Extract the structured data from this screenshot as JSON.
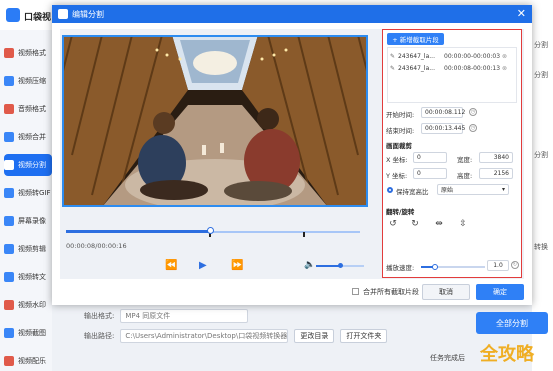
{
  "app": {
    "name": "口袋视",
    "sidebar": [
      {
        "label": "视频格式",
        "color": "#e05a4a"
      },
      {
        "label": "视频压缩",
        "color": "#3a86f7"
      },
      {
        "label": "音频格式",
        "color": "#e05a4a"
      },
      {
        "label": "视频合并",
        "color": "#3a86f7"
      },
      {
        "label": "视频分割",
        "color": "#e05a4a",
        "active": true
      },
      {
        "label": "视频转GIF",
        "color": "#3a86f7"
      },
      {
        "label": "屏幕录像",
        "color": "#3a86f7"
      },
      {
        "label": "视频剪辑",
        "color": "#3a86f7"
      },
      {
        "label": "视频转文",
        "color": "#3a86f7"
      },
      {
        "label": "视频水印",
        "color": "#e05a4a"
      },
      {
        "label": "视频截图",
        "color": "#3a86f7"
      },
      {
        "label": "视频配乐",
        "color": "#e05a4a"
      }
    ],
    "right_labels": [
      "分割",
      "分割",
      "分割",
      "转换"
    ],
    "output_format_label": "输出格式:",
    "output_format_value": "MP4  同原文件",
    "output_path_label": "输出路径:",
    "output_path_value": "C:\\Users\\Administrator\\Desktop\\口袋视频转换器",
    "change_dir": "更改目录",
    "open_folder": "打开文件夹",
    "split_all": "全部分割",
    "task_done": "任务完成后",
    "watermark": "全攻略"
  },
  "dialog": {
    "title": "编辑分割",
    "close": "✕",
    "time_display": "00:00:08/00:00:16",
    "playback": {
      "progress": 0.49,
      "clip_markers": [
        0.49,
        0.81
      ]
    },
    "volume": 0.5,
    "panel": {
      "add_clip": "+ 新增截取片段",
      "clips": [
        {
          "name": "243647_la...",
          "time": "00:00:00-00:00:03"
        },
        {
          "name": "243647_la...",
          "time": "00:00:08-00:00:13"
        }
      ],
      "start_label": "开始时间:",
      "start_value": "00:00:08.112",
      "end_label": "结束时间:",
      "end_value": "00:00:13.445",
      "frame_section": "画面裁剪",
      "x_label": "X 坐标:",
      "x_value": "0",
      "y_label": "Y 坐标:",
      "y_value": "0",
      "w_label": "宽度:",
      "w_value": "3840",
      "h_label": "高度:",
      "h_value": "2156",
      "keep_ratio": "保持宽高比",
      "ratio_value": "原始",
      "rotate_section": "翻转/旋转",
      "speed_label": "播放速度:",
      "speed_value": "1.0",
      "speed_level": 0.22
    },
    "merge_all": "合并所有截取片段",
    "cancel": "取消",
    "ok": "确定"
  }
}
